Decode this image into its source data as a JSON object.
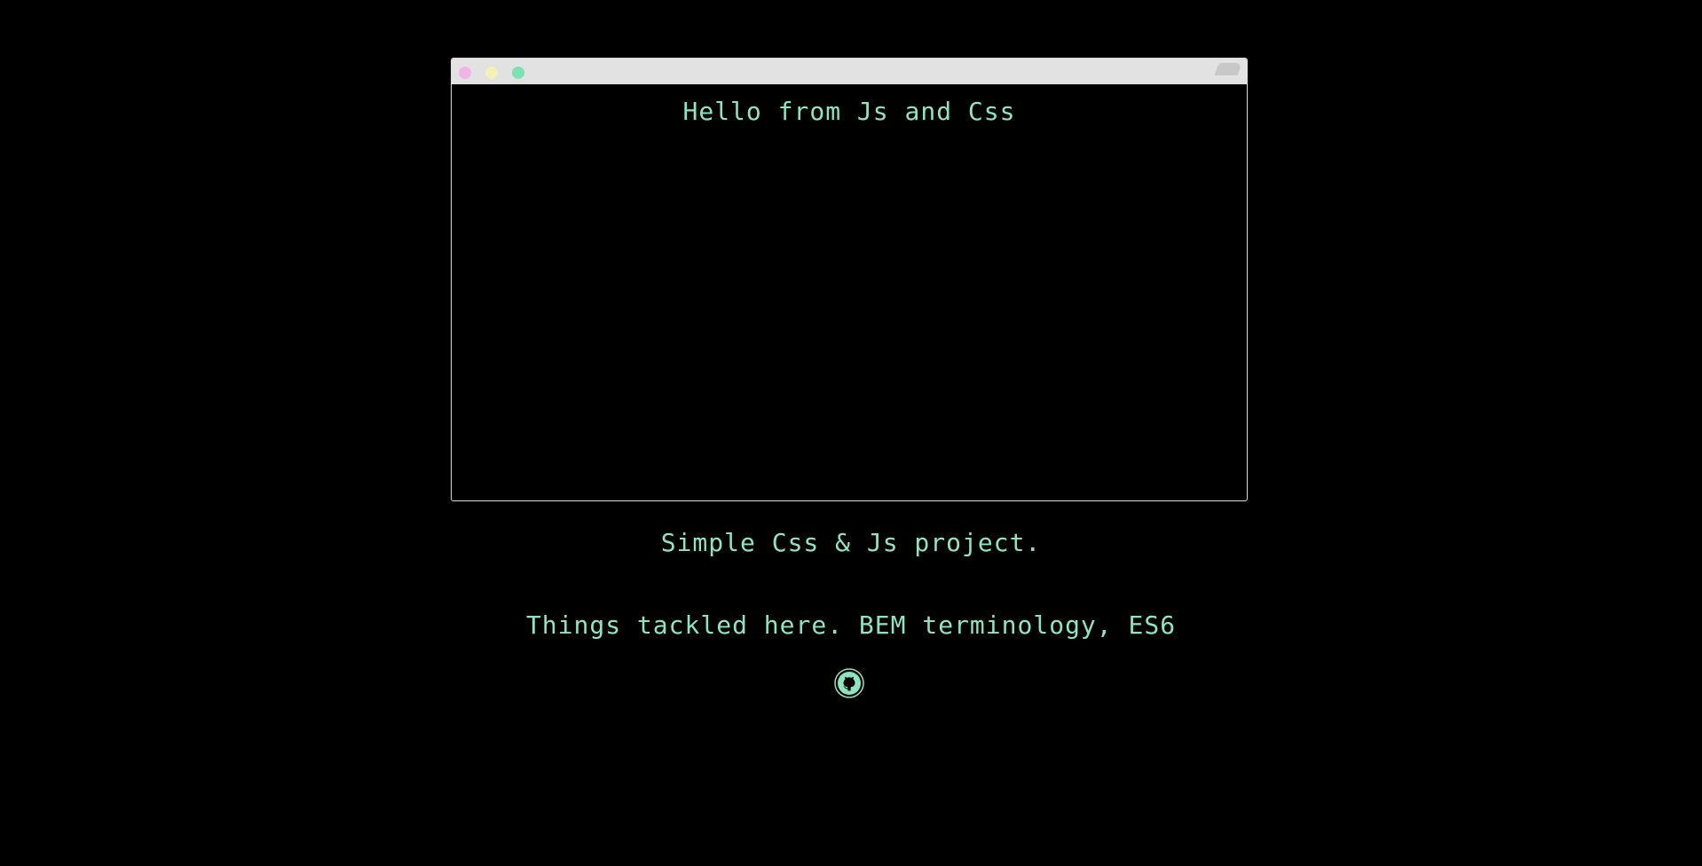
{
  "terminal": {
    "output": "Hello from Js and Css",
    "dots": {
      "close_color": "#f2b4e6",
      "minimize_color": "#f3f1b3",
      "maximize_color": "#7ee0b4"
    }
  },
  "info": {
    "subtitle": "Simple Css & Js project.",
    "tackled": "Things tackled here. BEM terminology, ES6"
  },
  "links": {
    "github_icon": "github-icon"
  },
  "colors": {
    "background": "#000000",
    "text": "#8ee3c0",
    "titlebar": "#e2e2e2",
    "border": "#d9d9d9"
  }
}
